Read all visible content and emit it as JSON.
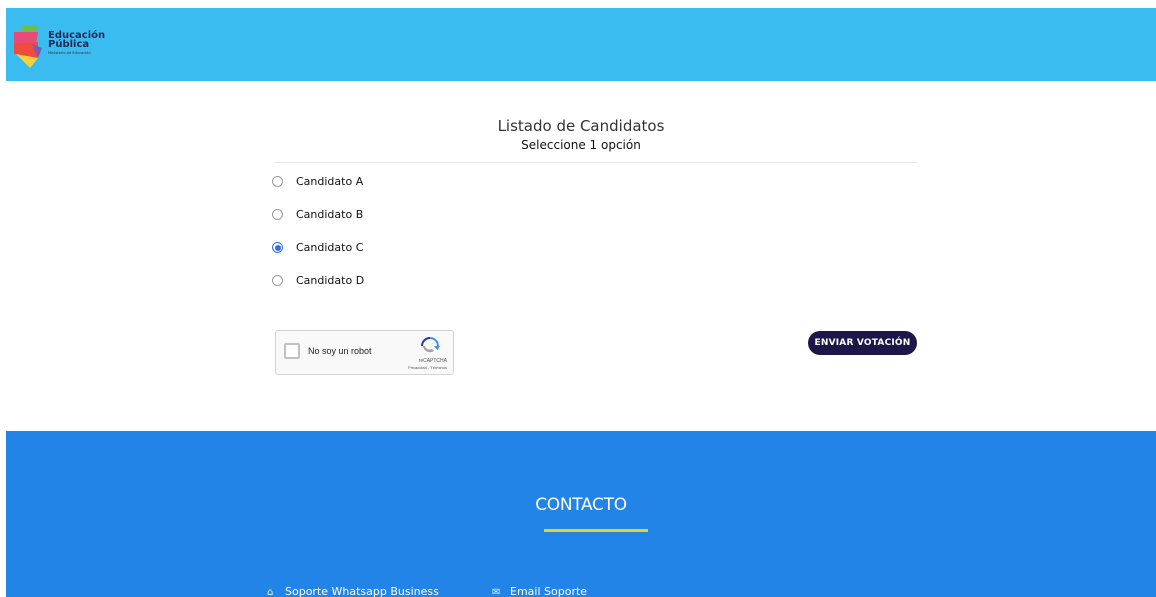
{
  "header": {
    "logo": {
      "title_line1": "Educación",
      "title_line2": "Pública",
      "subtitle": "Ministerio de Educación"
    },
    "background_color": "#3bbcf1"
  },
  "main": {
    "title": "Listado de Candidatos",
    "subtitle": "Seleccione 1 opción",
    "options": [
      {
        "label": "Candidato A",
        "checked": false
      },
      {
        "label": "Candidato B",
        "checked": false
      },
      {
        "label": "Candidato C",
        "checked": true
      },
      {
        "label": "Candidato D",
        "checked": false
      }
    ]
  },
  "recaptcha": {
    "label": "No soy un robot",
    "brand": "reCAPTCHA",
    "links": "Privacidad - Términos"
  },
  "submit": {
    "label": "ENVIAR VOTACIÓN",
    "color": "#1c1748"
  },
  "footer": {
    "title": "CONTACTO",
    "background_color": "#2184e6",
    "accent_color": "#e8d21e",
    "links": [
      {
        "icon": "home-icon",
        "label": "Soporte Whatsapp Business"
      },
      {
        "icon": "envelope-icon",
        "label": "Email Soporte"
      }
    ]
  }
}
